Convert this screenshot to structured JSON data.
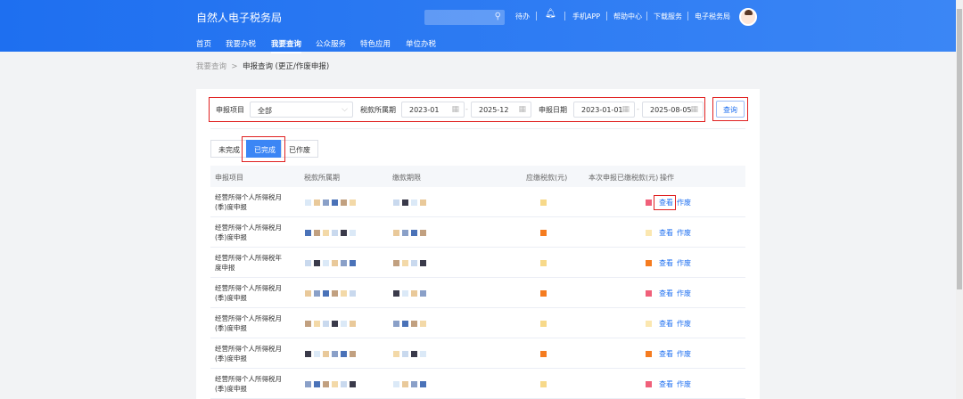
{
  "header": {
    "title": "自然人电子税务局",
    "todo": "待办",
    "links": [
      "手机APP",
      "帮助中心",
      "下载服务",
      "电子税务局"
    ]
  },
  "nav": [
    "首页",
    "我要办税",
    "我要查询",
    "公众服务",
    "特色应用",
    "单位办税"
  ],
  "breadcrumb": {
    "parent": "我要查询",
    "separator": ">",
    "current": "申报查询 (更正/作废申报)"
  },
  "filters": {
    "item_label": "申报项目",
    "item_value": "全部",
    "period_label": "税款所属期",
    "period_start": "2023-01",
    "period_end": "2025-12",
    "date_label": "申报日期",
    "date_start": "2023-01-01",
    "date_end": "2025-08-05",
    "dash": "-",
    "query_button": "查询"
  },
  "tabs": [
    "未完成",
    "已完成",
    "已作废"
  ],
  "table": {
    "headers": [
      "申报项目",
      "税款所属期",
      "缴款期限",
      "应缴税款(元)",
      "本次申报已缴税款(元)",
      "操作"
    ],
    "rows": [
      {
        "name": "经营所得个人所得税月(季)度申报"
      },
      {
        "name": "经营所得个人所得税月(季)度申报"
      },
      {
        "name": "经营所得个人所得税年度申报"
      },
      {
        "name": "经营所得个人所得税月(季)度申报"
      },
      {
        "name": "经营所得个人所得税月(季)度申报"
      },
      {
        "name": "经营所得个人所得税月(季)度申报"
      },
      {
        "name": "经营所得个人所得税月(季)度申报"
      }
    ],
    "view_label": "查看",
    "void_label": "作废"
  },
  "colors": {
    "brand": "#1e6ff0",
    "highlight": "#e02020"
  }
}
